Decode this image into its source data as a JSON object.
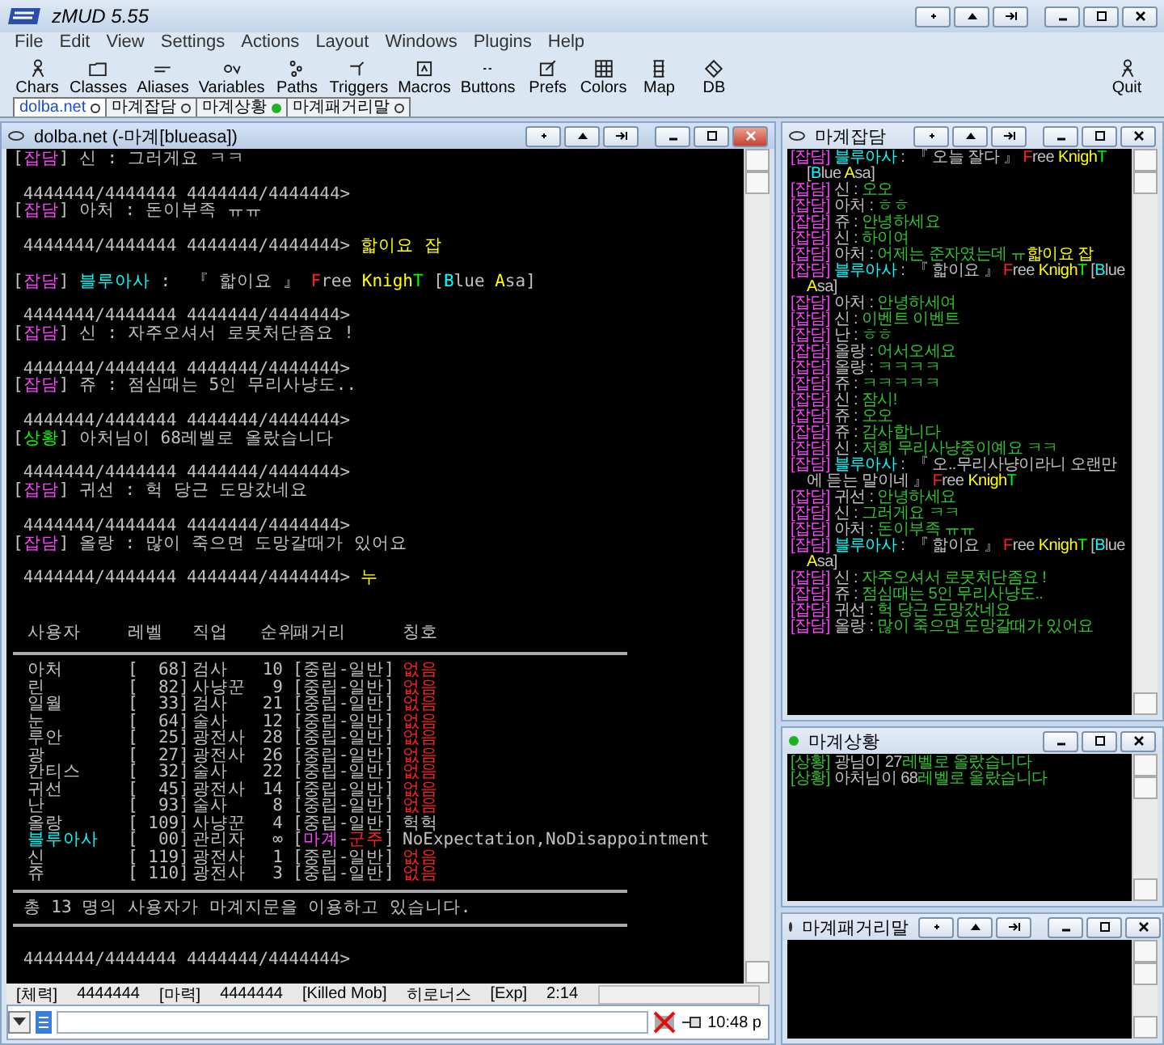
{
  "window": {
    "title": "zMUD 5.55"
  },
  "menu": [
    "File",
    "Edit",
    "View",
    "Settings",
    "Actions",
    "Layout",
    "Windows",
    "Plugins",
    "Help"
  ],
  "toolbar": [
    {
      "label": "Chars"
    },
    {
      "label": "Classes"
    },
    {
      "label": "Aliases"
    },
    {
      "label": "Variables"
    },
    {
      "label": "Paths"
    },
    {
      "label": "Triggers"
    },
    {
      "label": "Macros"
    },
    {
      "label": "Buttons"
    },
    {
      "label": "Prefs"
    },
    {
      "label": "Colors"
    },
    {
      "label": "Map"
    },
    {
      "label": "DB"
    }
  ],
  "quit": {
    "label": "Quit"
  },
  "tabs": [
    {
      "label": "dolba.net",
      "selected": true,
      "activity": false
    },
    {
      "label": "마계잡담",
      "selected": false,
      "activity": false
    },
    {
      "label": "마계상황",
      "selected": false,
      "activity": true
    },
    {
      "label": "마계패거리말",
      "selected": false,
      "activity": false
    }
  ],
  "main_window": {
    "title": "dolba.net (-마계[blueasa])",
    "focused": true,
    "activity": false,
    "extra_buttons": true,
    "output": [
      {
        "kind": "line",
        "segments": [
          {
            "text": "["
          },
          {
            "text": "잡담",
            "color": "#ff40ff"
          },
          {
            "text": "] 신 : 그러게요 ㅋㅋ"
          }
        ]
      },
      {
        "kind": "blank"
      },
      {
        "kind": "line",
        "segments": [
          {
            "text": " 4444444/4444444 4444444/4444444>"
          }
        ]
      },
      {
        "kind": "line",
        "segments": [
          {
            "text": "["
          },
          {
            "text": "잡담",
            "color": "#ff40ff"
          },
          {
            "text": "] 아처 : 돈이부족 ㅠㅠ"
          }
        ]
      },
      {
        "kind": "blank"
      },
      {
        "kind": "line",
        "segments": [
          {
            "text": " 4444444/4444444 4444444/4444444> "
          },
          {
            "text": "핣이요 잡",
            "color": "#ffff00"
          }
        ]
      },
      {
        "kind": "blank"
      },
      {
        "kind": "line",
        "segments": [
          {
            "text": "["
          },
          {
            "text": "잡담",
            "color": "#ff40ff"
          },
          {
            "text": "] "
          },
          {
            "text": "블루아사",
            "color": "#00ffff"
          },
          {
            "text": " :  『 핣이요 』 "
          },
          {
            "text": "F",
            "color": "#ff2020"
          },
          {
            "text": "ree "
          },
          {
            "text": "Knigh",
            "color": "#ffff00"
          },
          {
            "text": "T",
            "color": "#00ff00"
          },
          {
            "text": " ["
          },
          {
            "text": "B",
            "color": "#00ffff"
          },
          {
            "text": "lue "
          },
          {
            "text": "A",
            "color": "#ffff00"
          },
          {
            "text": "sa]"
          }
        ]
      },
      {
        "kind": "blank"
      },
      {
        "kind": "line",
        "segments": [
          {
            "text": " 4444444/4444444 4444444/4444444>"
          }
        ]
      },
      {
        "kind": "line",
        "segments": [
          {
            "text": "["
          },
          {
            "text": "잡담",
            "color": "#ff40ff"
          },
          {
            "text": "] 신 : 자주오셔서 로못처단좀요 !"
          }
        ]
      },
      {
        "kind": "blank"
      },
      {
        "kind": "line",
        "segments": [
          {
            "text": " 4444444/4444444 4444444/4444444>"
          }
        ]
      },
      {
        "kind": "line",
        "segments": [
          {
            "text": "["
          },
          {
            "text": "잡담",
            "color": "#ff40ff"
          },
          {
            "text": "] 쥬 : 점심때는 5인 무리사냥도.."
          }
        ]
      },
      {
        "kind": "blank"
      },
      {
        "kind": "line",
        "segments": [
          {
            "text": " 4444444/4444444 4444444/4444444>"
          }
        ]
      },
      {
        "kind": "line",
        "segments": [
          {
            "text": "["
          },
          {
            "text": "상황",
            "color": "#00ff00"
          },
          {
            "text": "] 아처님이 68레벨로 올랐습니다"
          }
        ]
      },
      {
        "kind": "blank"
      },
      {
        "kind": "line",
        "segments": [
          {
            "text": " 4444444/4444444 4444444/4444444>"
          }
        ]
      },
      {
        "kind": "line",
        "segments": [
          {
            "text": "["
          },
          {
            "text": "잡담",
            "color": "#ff40ff"
          },
          {
            "text": "] 귀선 : 헉 당근 도망갔네요"
          }
        ]
      },
      {
        "kind": "blank"
      },
      {
        "kind": "line",
        "segments": [
          {
            "text": " 4444444/4444444 4444444/4444444>"
          }
        ]
      },
      {
        "kind": "line",
        "segments": [
          {
            "text": "["
          },
          {
            "text": "잡담",
            "color": "#ff40ff"
          },
          {
            "text": "] 올랑 : 많이 죽으면 도망갈때가 있어요"
          }
        ]
      },
      {
        "kind": "blank"
      },
      {
        "kind": "line",
        "segments": [
          {
            "text": " 4444444/4444444 4444444/4444444> "
          },
          {
            "text": "누",
            "color": "#ffff00"
          }
        ]
      },
      {
        "kind": "blank"
      },
      {
        "kind": "blank"
      },
      {
        "kind": "table",
        "columns": [
          "사용자",
          "레벨",
          "직업",
          "순위",
          "패거리",
          "칭호"
        ],
        "rows": [
          {
            "user": {
              "text": "아처"
            },
            "level": "[  68]",
            "job": "검사",
            "rank": "10",
            "party": [
              {
                "text": "[중립-일반]"
              }
            ],
            "title": {
              "text": "없음",
              "color": "#ff2020"
            }
          },
          {
            "user": {
              "text": "린"
            },
            "level": "[  82]",
            "job": "사냥꾼",
            "rank": "9",
            "party": [
              {
                "text": "[중립-일반]"
              }
            ],
            "title": {
              "text": "없음",
              "color": "#ff2020"
            }
          },
          {
            "user": {
              "text": "일월"
            },
            "level": "[  33]",
            "job": "검사",
            "rank": "21",
            "party": [
              {
                "text": "[중립-일반]"
              }
            ],
            "title": {
              "text": "없음",
              "color": "#ff2020"
            }
          },
          {
            "user": {
              "text": "눈"
            },
            "level": "[  64]",
            "job": "술사",
            "rank": "12",
            "party": [
              {
                "text": "[중립-일반]"
              }
            ],
            "title": {
              "text": "없음",
              "color": "#ff2020"
            }
          },
          {
            "user": {
              "text": "루안"
            },
            "level": "[  25]",
            "job": "광전사",
            "rank": "28",
            "party": [
              {
                "text": "[중립-일반]"
              }
            ],
            "title": {
              "text": "없음",
              "color": "#ff2020"
            }
          },
          {
            "user": {
              "text": "광"
            },
            "level": "[  27]",
            "job": "광전사",
            "rank": "26",
            "party": [
              {
                "text": "[중립-일반]"
              }
            ],
            "title": {
              "text": "없음",
              "color": "#ff2020"
            }
          },
          {
            "user": {
              "text": "칸티스"
            },
            "level": "[  32]",
            "job": "술사",
            "rank": "22",
            "party": [
              {
                "text": "[중립-일반]"
              }
            ],
            "title": {
              "text": "없음",
              "color": "#ff2020"
            }
          },
          {
            "user": {
              "text": "귀선"
            },
            "level": "[  45]",
            "job": "광전사",
            "rank": "14",
            "party": [
              {
                "text": "[중립-일반]"
              }
            ],
            "title": {
              "text": "없음",
              "color": "#ff2020"
            }
          },
          {
            "user": {
              "text": "난"
            },
            "level": "[  93]",
            "job": "술사",
            "rank": "8",
            "party": [
              {
                "text": "[중립-일반]"
              }
            ],
            "title": {
              "text": "없음",
              "color": "#ff2020"
            }
          },
          {
            "user": {
              "text": "올랑"
            },
            "level": "[ 109]",
            "job": "사냥꾼",
            "rank": "4",
            "party": [
              {
                "text": "[중립-일반]"
              }
            ],
            "title": {
              "text": "헉헉"
            }
          },
          {
            "user": {
              "text": "블루아사",
              "color": "#00ffff"
            },
            "level": "[  00]",
            "job": "관리자",
            "rank": "∞",
            "party": [
              {
                "text": "["
              },
              {
                "text": "마계",
                "color": "#ff40ff"
              },
              {
                "text": "-"
              },
              {
                "text": "군주",
                "color": "#ff2020"
              },
              {
                "text": "]"
              }
            ],
            "title": {
              "text": "NoExpectation,NoDisappointment"
            }
          },
          {
            "user": {
              "text": "신"
            },
            "level": "[ 119]",
            "job": "광전사",
            "rank": "1",
            "party": [
              {
                "text": "[중립-일반]"
              }
            ],
            "title": {
              "text": "없음",
              "color": "#ff2020"
            }
          },
          {
            "user": {
              "text": "쥬"
            },
            "level": "[ 110]",
            "job": "광전사",
            "rank": "3",
            "party": [
              {
                "text": "[중립-일반]"
              }
            ],
            "title": {
              "text": "없음",
              "color": "#ff2020"
            }
          }
        ]
      },
      {
        "kind": "rule"
      },
      {
        "kind": "line",
        "segments": [
          {
            "text": " 총 13 명의 사용자가 마계지문을 이용하고 있습니다."
          }
        ]
      },
      {
        "kind": "rule"
      },
      {
        "kind": "blank"
      },
      {
        "kind": "line",
        "segments": [
          {
            "text": " 4444444/4444444 4444444/4444444>"
          }
        ]
      }
    ]
  },
  "status_bar": [
    "[체력]",
    "4444444",
    "[마력]",
    "4444444",
    "[Killed Mob]",
    "히로너스",
    "[Exp]",
    "2:14"
  ],
  "clock": "10:48 p",
  "side_windows": [
    {
      "title": "마계잡담",
      "focused": false,
      "activity": false,
      "extra_buttons": true,
      "lines": [
        [
          {
            "text": "[잡담] ",
            "color": "#ff40ff"
          },
          {
            "text": "블루아사",
            "color": "#00ffff"
          },
          {
            "text": " :  『 오늘 잘다 』 "
          },
          {
            "text": "F",
            "color": "#ff2020"
          },
          {
            "text": "ree "
          },
          {
            "text": "Knigh",
            "color": "#ffff00"
          },
          {
            "text": "T",
            "color": "#00ff00"
          },
          {
            "text": " ["
          },
          {
            "text": "B",
            "color": "#00ffff"
          },
          {
            "text": "lue "
          },
          {
            "text": "A",
            "color": "#ffff00"
          },
          {
            "text": "sa]"
          }
        ],
        [
          {
            "text": "[잡담] ",
            "color": "#ff40ff"
          },
          {
            "text": "신 : "
          },
          {
            "text": "오오",
            "color": "#30c030"
          }
        ],
        [
          {
            "text": "[잡담] ",
            "color": "#ff40ff"
          },
          {
            "text": "아처 : "
          },
          {
            "text": "ㅎㅎ",
            "color": "#30c030"
          }
        ],
        [
          {
            "text": "[잡담] ",
            "color": "#ff40ff"
          },
          {
            "text": "쥬 : "
          },
          {
            "text": "안녕하세요",
            "color": "#30c030"
          }
        ],
        [
          {
            "text": "[잡담] ",
            "color": "#ff40ff"
          },
          {
            "text": "신 : "
          },
          {
            "text": "하이여",
            "color": "#30c030"
          }
        ],
        [
          {
            "text": "[잡담] ",
            "color": "#ff40ff"
          },
          {
            "text": "아처 : "
          },
          {
            "text": "어제는 준자였는데 ㅠ",
            "color": "#30c030"
          },
          {
            "text": "핣이요 잡",
            "color": "#ffff00"
          }
        ],
        [
          {
            "text": "[잡담] ",
            "color": "#ff40ff"
          },
          {
            "text": "블루아사",
            "color": "#00ffff"
          },
          {
            "text": " :  『 핣이요 』 "
          },
          {
            "text": "F",
            "color": "#ff2020"
          },
          {
            "text": "ree "
          },
          {
            "text": "Knigh",
            "color": "#ffff00"
          },
          {
            "text": "T",
            "color": "#00ff00"
          },
          {
            "text": " ["
          },
          {
            "text": "B",
            "color": "#00ffff"
          },
          {
            "text": "lue "
          },
          {
            "text": "A",
            "color": "#ffff00"
          },
          {
            "text": "sa]"
          }
        ],
        [
          {
            "text": "[잡담] ",
            "color": "#ff40ff"
          },
          {
            "text": "아처 : "
          },
          {
            "text": "안녕하세여",
            "color": "#30c030"
          }
        ],
        [
          {
            "text": "[잡담] ",
            "color": "#ff40ff"
          },
          {
            "text": "신 : "
          },
          {
            "text": "이벤트 이벤트",
            "color": "#30c030"
          }
        ],
        [
          {
            "text": "[잡담] ",
            "color": "#ff40ff"
          },
          {
            "text": "난 : "
          },
          {
            "text": "ㅎㅎ",
            "color": "#30c030"
          }
        ],
        [
          {
            "text": "[잡담] ",
            "color": "#ff40ff"
          },
          {
            "text": "올랑 : "
          },
          {
            "text": "어서오세요",
            "color": "#30c030"
          }
        ],
        [
          {
            "text": "[잡담] ",
            "color": "#ff40ff"
          },
          {
            "text": "올랑 : "
          },
          {
            "text": "ㅋㅋㅋㅋ",
            "color": "#30c030"
          }
        ],
        [
          {
            "text": "[잡담] ",
            "color": "#ff40ff"
          },
          {
            "text": "쥬 : "
          },
          {
            "text": "ㅋㅋㅋㅋㅋ",
            "color": "#30c030"
          }
        ],
        [
          {
            "text": "[잡담] ",
            "color": "#ff40ff"
          },
          {
            "text": "신 : "
          },
          {
            "text": "잠시!",
            "color": "#30c030"
          }
        ],
        [
          {
            "text": "[잡담] ",
            "color": "#ff40ff"
          },
          {
            "text": "쥬 : "
          },
          {
            "text": "오오",
            "color": "#30c030"
          }
        ],
        [
          {
            "text": "[잡담] ",
            "color": "#ff40ff"
          },
          {
            "text": "쥬 : "
          },
          {
            "text": "감사합니다",
            "color": "#30c030"
          }
        ],
        [
          {
            "text": "[잡담] ",
            "color": "#ff40ff"
          },
          {
            "text": "신 : "
          },
          {
            "text": "저희 무리사냥중이예요 ㅋㅋ",
            "color": "#30c030"
          }
        ],
        [
          {
            "text": "[잡담] ",
            "color": "#ff40ff"
          },
          {
            "text": "블루아사",
            "color": "#00ffff"
          },
          {
            "text": " :  『 오..무리사냥이라니 오랜만에 듣는 말이네 』 "
          },
          {
            "text": "F",
            "color": "#ff2020"
          },
          {
            "text": "ree "
          },
          {
            "text": "Knigh",
            "color": "#ffff00"
          },
          {
            "text": "T",
            "color": "#00ff00"
          }
        ],
        [
          {
            "text": "[잡담] ",
            "color": "#ff40ff"
          },
          {
            "text": "귀선 : "
          },
          {
            "text": "안녕하세요",
            "color": "#30c030"
          }
        ],
        [
          {
            "text": "[잡담] ",
            "color": "#ff40ff"
          },
          {
            "text": "신 : "
          },
          {
            "text": "그러게요 ㅋㅋ",
            "color": "#30c030"
          }
        ],
        [
          {
            "text": "[잡담] ",
            "color": "#ff40ff"
          },
          {
            "text": "아처 : "
          },
          {
            "text": "돈이부족 ㅠㅠ",
            "color": "#30c030"
          }
        ],
        [
          {
            "text": "[잡담] ",
            "color": "#ff40ff"
          },
          {
            "text": "블루아사",
            "color": "#00ffff"
          },
          {
            "text": " :  『 핣이요 』 "
          },
          {
            "text": "F",
            "color": "#ff2020"
          },
          {
            "text": "ree "
          },
          {
            "text": "Knigh",
            "color": "#ffff00"
          },
          {
            "text": "T",
            "color": "#00ff00"
          },
          {
            "text": " ["
          },
          {
            "text": "B",
            "color": "#00ffff"
          },
          {
            "text": "lue "
          },
          {
            "text": "A",
            "color": "#ffff00"
          },
          {
            "text": "sa]"
          }
        ],
        [
          {
            "text": "[잡담] ",
            "color": "#ff40ff"
          },
          {
            "text": "신 : "
          },
          {
            "text": "자주오셔서 로못처단좀요 !",
            "color": "#30c030"
          }
        ],
        [
          {
            "text": "[잡담] ",
            "color": "#ff40ff"
          },
          {
            "text": "쥬 : "
          },
          {
            "text": "점심때는 5인 무리사냥도..",
            "color": "#30c030"
          }
        ],
        [
          {
            "text": "[잡담] ",
            "color": "#ff40ff"
          },
          {
            "text": "귀선 : "
          },
          {
            "text": "헉 당근 도망갔네요",
            "color": "#30c030"
          }
        ],
        [
          {
            "text": "[잡담] ",
            "color": "#ff40ff"
          },
          {
            "text": "올랑 : "
          },
          {
            "text": "많이 죽으면 도망갈때가 있어요",
            "color": "#30c030"
          }
        ]
      ]
    },
    {
      "title": "마계상황",
      "focused": false,
      "activity": true,
      "extra_buttons": false,
      "lines": [
        [
          {
            "text": "[상황] ",
            "color": "#30c030"
          },
          {
            "text": "광님이 27"
          },
          {
            "text": "레벨로 올랐습니다",
            "color": "#30c030"
          }
        ],
        [
          {
            "text": "[상황] ",
            "color": "#30c030"
          },
          {
            "text": "아처님이 68"
          },
          {
            "text": "레벨로 올랐습니다",
            "color": "#30c030"
          }
        ]
      ]
    },
    {
      "title": "마계패거리말",
      "focused": false,
      "activity": false,
      "extra_buttons": true
    }
  ]
}
